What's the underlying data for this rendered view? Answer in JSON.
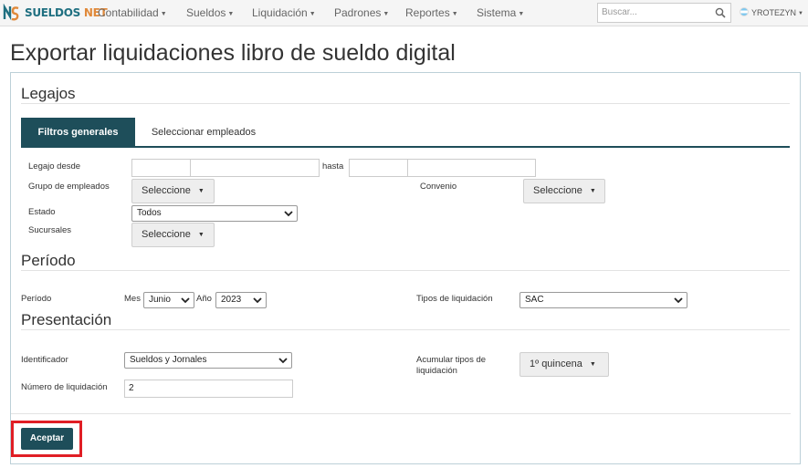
{
  "brand": {
    "part1": "SUELDOS",
    "part2": "NET"
  },
  "nav": {
    "items": [
      {
        "label": "Contabilidad"
      },
      {
        "label": "Sueldos"
      },
      {
        "label": "Liquidación"
      },
      {
        "label": "Padrones"
      },
      {
        "label": "Reportes"
      },
      {
        "label": "Sistema"
      }
    ],
    "search_placeholder": "Buscar...",
    "user": "YROTEZYN"
  },
  "page": {
    "title": "Exportar liquidaciones libro de sueldo digital"
  },
  "legajos": {
    "title": "Legajos",
    "tabs": [
      {
        "label": "Filtros generales"
      },
      {
        "label": "Seleccionar empleados"
      }
    ],
    "legajo_desde_label": "Legajo desde",
    "hasta_label": "hasta",
    "grupo_label": "Grupo de empleados",
    "grupo_value": "Seleccione",
    "convenio_label": "Convenio",
    "convenio_value": "Seleccione",
    "estado_label": "Estado",
    "estado_value": "Todos",
    "sucursales_label": "Sucursales",
    "sucursales_value": "Seleccione"
  },
  "periodo": {
    "title": "Período",
    "periodo_label": "Período",
    "mes_label": "Mes",
    "mes_value": "Junio",
    "anio_label": "Año",
    "anio_value": "2023",
    "tipos_label": "Tipos de liquidación",
    "tipos_value": "SAC"
  },
  "presentacion": {
    "title": "Presentación",
    "identificador_label": "Identificador",
    "identificador_value": "Sueldos y Jornales",
    "acumular_label_1": "Acumular tipos de",
    "acumular_label_2": "liquidación",
    "acumular_value": "1º quincena",
    "numero_label": "Número de liquidación",
    "numero_value": "2"
  },
  "actions": {
    "accept_label": "Aceptar"
  },
  "colors": {
    "primary": "#1e4e5a",
    "highlight": "#e01e25",
    "brand_teal": "#1f6f80",
    "brand_orange": "#e0893a"
  }
}
